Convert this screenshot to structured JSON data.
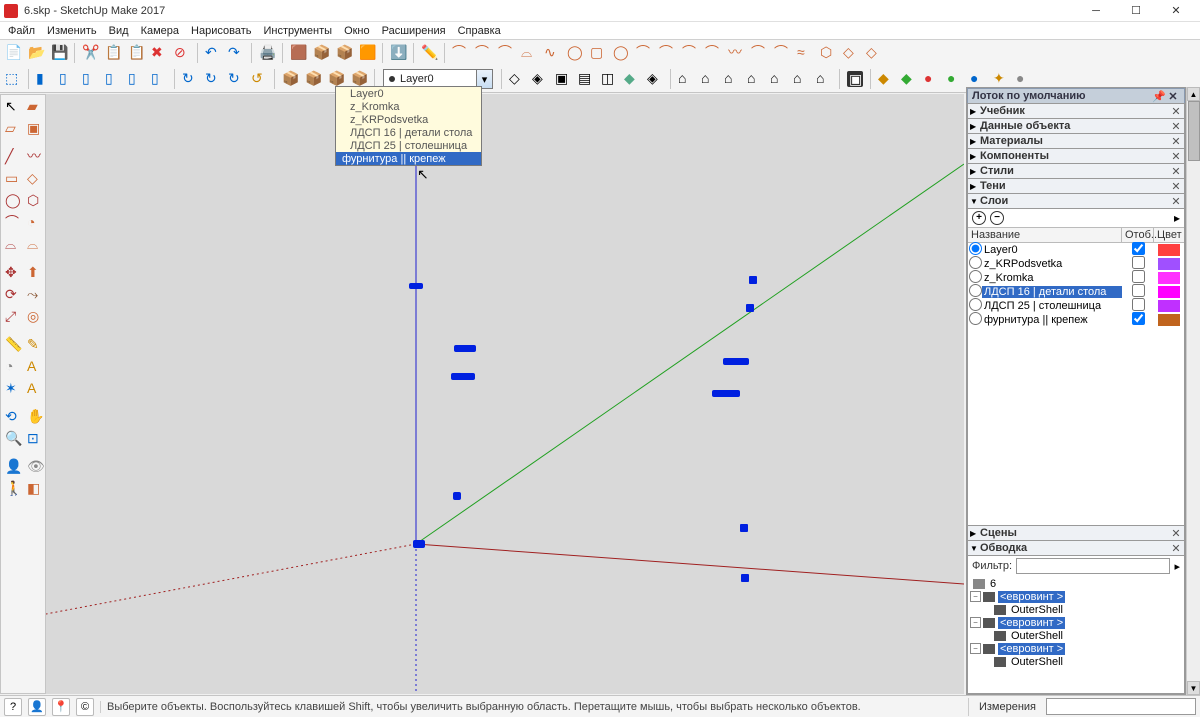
{
  "window": {
    "title": "6.skp - SketchUp Make 2017"
  },
  "menu": [
    "Файл",
    "Изменить",
    "Вид",
    "Камера",
    "Нарисовать",
    "Инструменты",
    "Окно",
    "Расширения",
    "Справка"
  ],
  "layer_selector": {
    "current": "Layer0"
  },
  "layer_dropdown_items": [
    {
      "label": "Layer0",
      "highlighted": false
    },
    {
      "label": "z_Kromka",
      "highlighted": false
    },
    {
      "label": "z_KRPodsvetka",
      "highlighted": false
    },
    {
      "label": "ЛДСП 16 | детали стола",
      "highlighted": false
    },
    {
      "label": "ЛДСП 25 | столешница",
      "highlighted": false
    },
    {
      "label": "фурнитура || крепеж",
      "highlighted": true
    }
  ],
  "tray": {
    "title": "Лоток по умолчанию"
  },
  "sections": {
    "tutorial": "Учебник",
    "entity": "Данные объекта",
    "materials": "Материалы",
    "components": "Компоненты",
    "styles": "Стили",
    "shadows": "Тени",
    "layers": "Слои",
    "scenes": "Сцены",
    "outliner": "Обводка"
  },
  "layers_panel": {
    "headers": {
      "name": "Название",
      "visible": "Отоб...",
      "color": "Цвет"
    },
    "rows": [
      {
        "name": "Layer0",
        "active": true,
        "visible": true,
        "color": "#ff4040",
        "selected": false
      },
      {
        "name": "z_KRPodsvetka",
        "active": false,
        "visible": false,
        "color": "#a050ff",
        "selected": false
      },
      {
        "name": "z_Kromka",
        "active": false,
        "visible": false,
        "color": "#ff30ff",
        "selected": false
      },
      {
        "name": "ЛДСП 16 | детали стола",
        "active": false,
        "visible": false,
        "color": "#ff00ff",
        "selected": true
      },
      {
        "name": "ЛДСП 25 | столешница",
        "active": false,
        "visible": false,
        "color": "#c030ff",
        "selected": false
      },
      {
        "name": "фурнитура || крепеж",
        "active": false,
        "visible": true,
        "color": "#c0641e",
        "selected": false
      }
    ]
  },
  "outliner": {
    "filter_label": "Фильтр:",
    "filter_value": "",
    "root": "6",
    "items": [
      {
        "label": "<евровинт >",
        "type": "comp"
      },
      {
        "label": "OuterShell",
        "type": "group"
      },
      {
        "label": "<евровинт >",
        "type": "comp"
      },
      {
        "label": "OuterShell",
        "type": "group"
      },
      {
        "label": "<евровинт >",
        "type": "comp"
      },
      {
        "label": "OuterShell",
        "type": "group"
      }
    ]
  },
  "statusbar": {
    "hint": "Выберите объекты. Воспользуйтесь клавишей Shift, чтобы увеличить выбранную область. Перетащите мышь, чтобы выбрать несколько объектов.",
    "measure_label": "Измерения"
  }
}
